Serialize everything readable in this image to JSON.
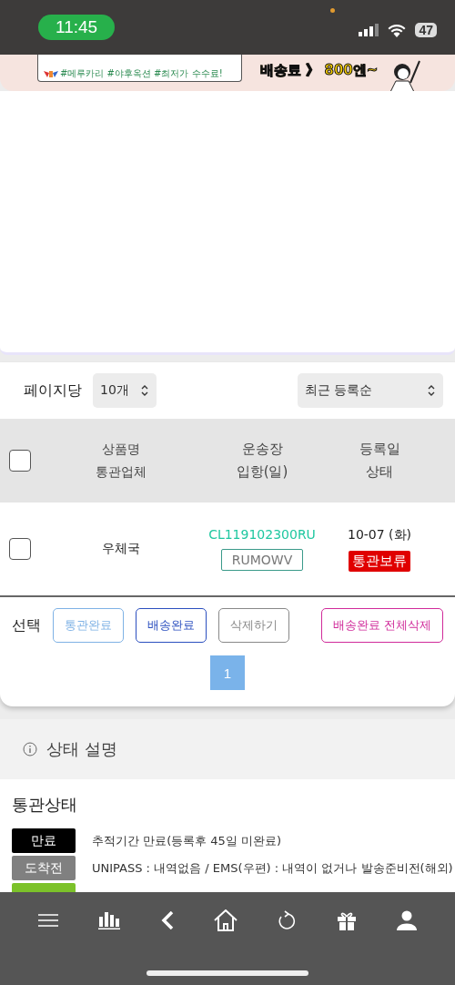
{
  "status_bar": {
    "time": "11:45",
    "battery": "47"
  },
  "banner": {
    "tags": "#메루카리 #야후옥션 #최저가 수수료!",
    "promo": "배송료 》 800엔~"
  },
  "controls": {
    "per_page_label": "페이지당",
    "per_page": "10개",
    "sort": "최근 등록순"
  },
  "table": {
    "columns": [
      {
        "line1": "상품명",
        "line2": "통관업체"
      },
      {
        "line1": "운송장",
        "line2": "입항(일)"
      },
      {
        "line1": "등록일",
        "line2": "상태"
      }
    ],
    "header_checked": false,
    "rows": [
      {
        "checked": false,
        "customs": "우체국",
        "tracking": "CL119102300RU",
        "code": "RUMOWV",
        "date": "10-07 (화)",
        "status": "통관보류",
        "color": "#e00000"
      }
    ]
  },
  "actions": {
    "label": "선택",
    "buttons": [
      {
        "label": "통관완료",
        "color": "#7fb2e5"
      },
      {
        "label": "배송완료",
        "color": "#2b4fbf"
      },
      {
        "label": "삭제하기",
        "color": "#888888"
      },
      {
        "label": "배송완료 전체삭제",
        "color": "#d02a9a"
      }
    ]
  },
  "pagination": [
    {
      "label": "1",
      "selected": true
    }
  ],
  "status_help": {
    "title": "상태 설명",
    "section": "통관상태",
    "items": [
      {
        "label": "만료",
        "color": "#000000",
        "text": "추적기간 만료(등록후 45일 미완료)"
      },
      {
        "label": "도착전",
        "color": "#808080",
        "text": "UNIPASS : 내역없음 / EMS(우편) : 내역이 없거나 발송준비전(해외)"
      },
      {
        "color": "#7cc22a"
      }
    ]
  }
}
